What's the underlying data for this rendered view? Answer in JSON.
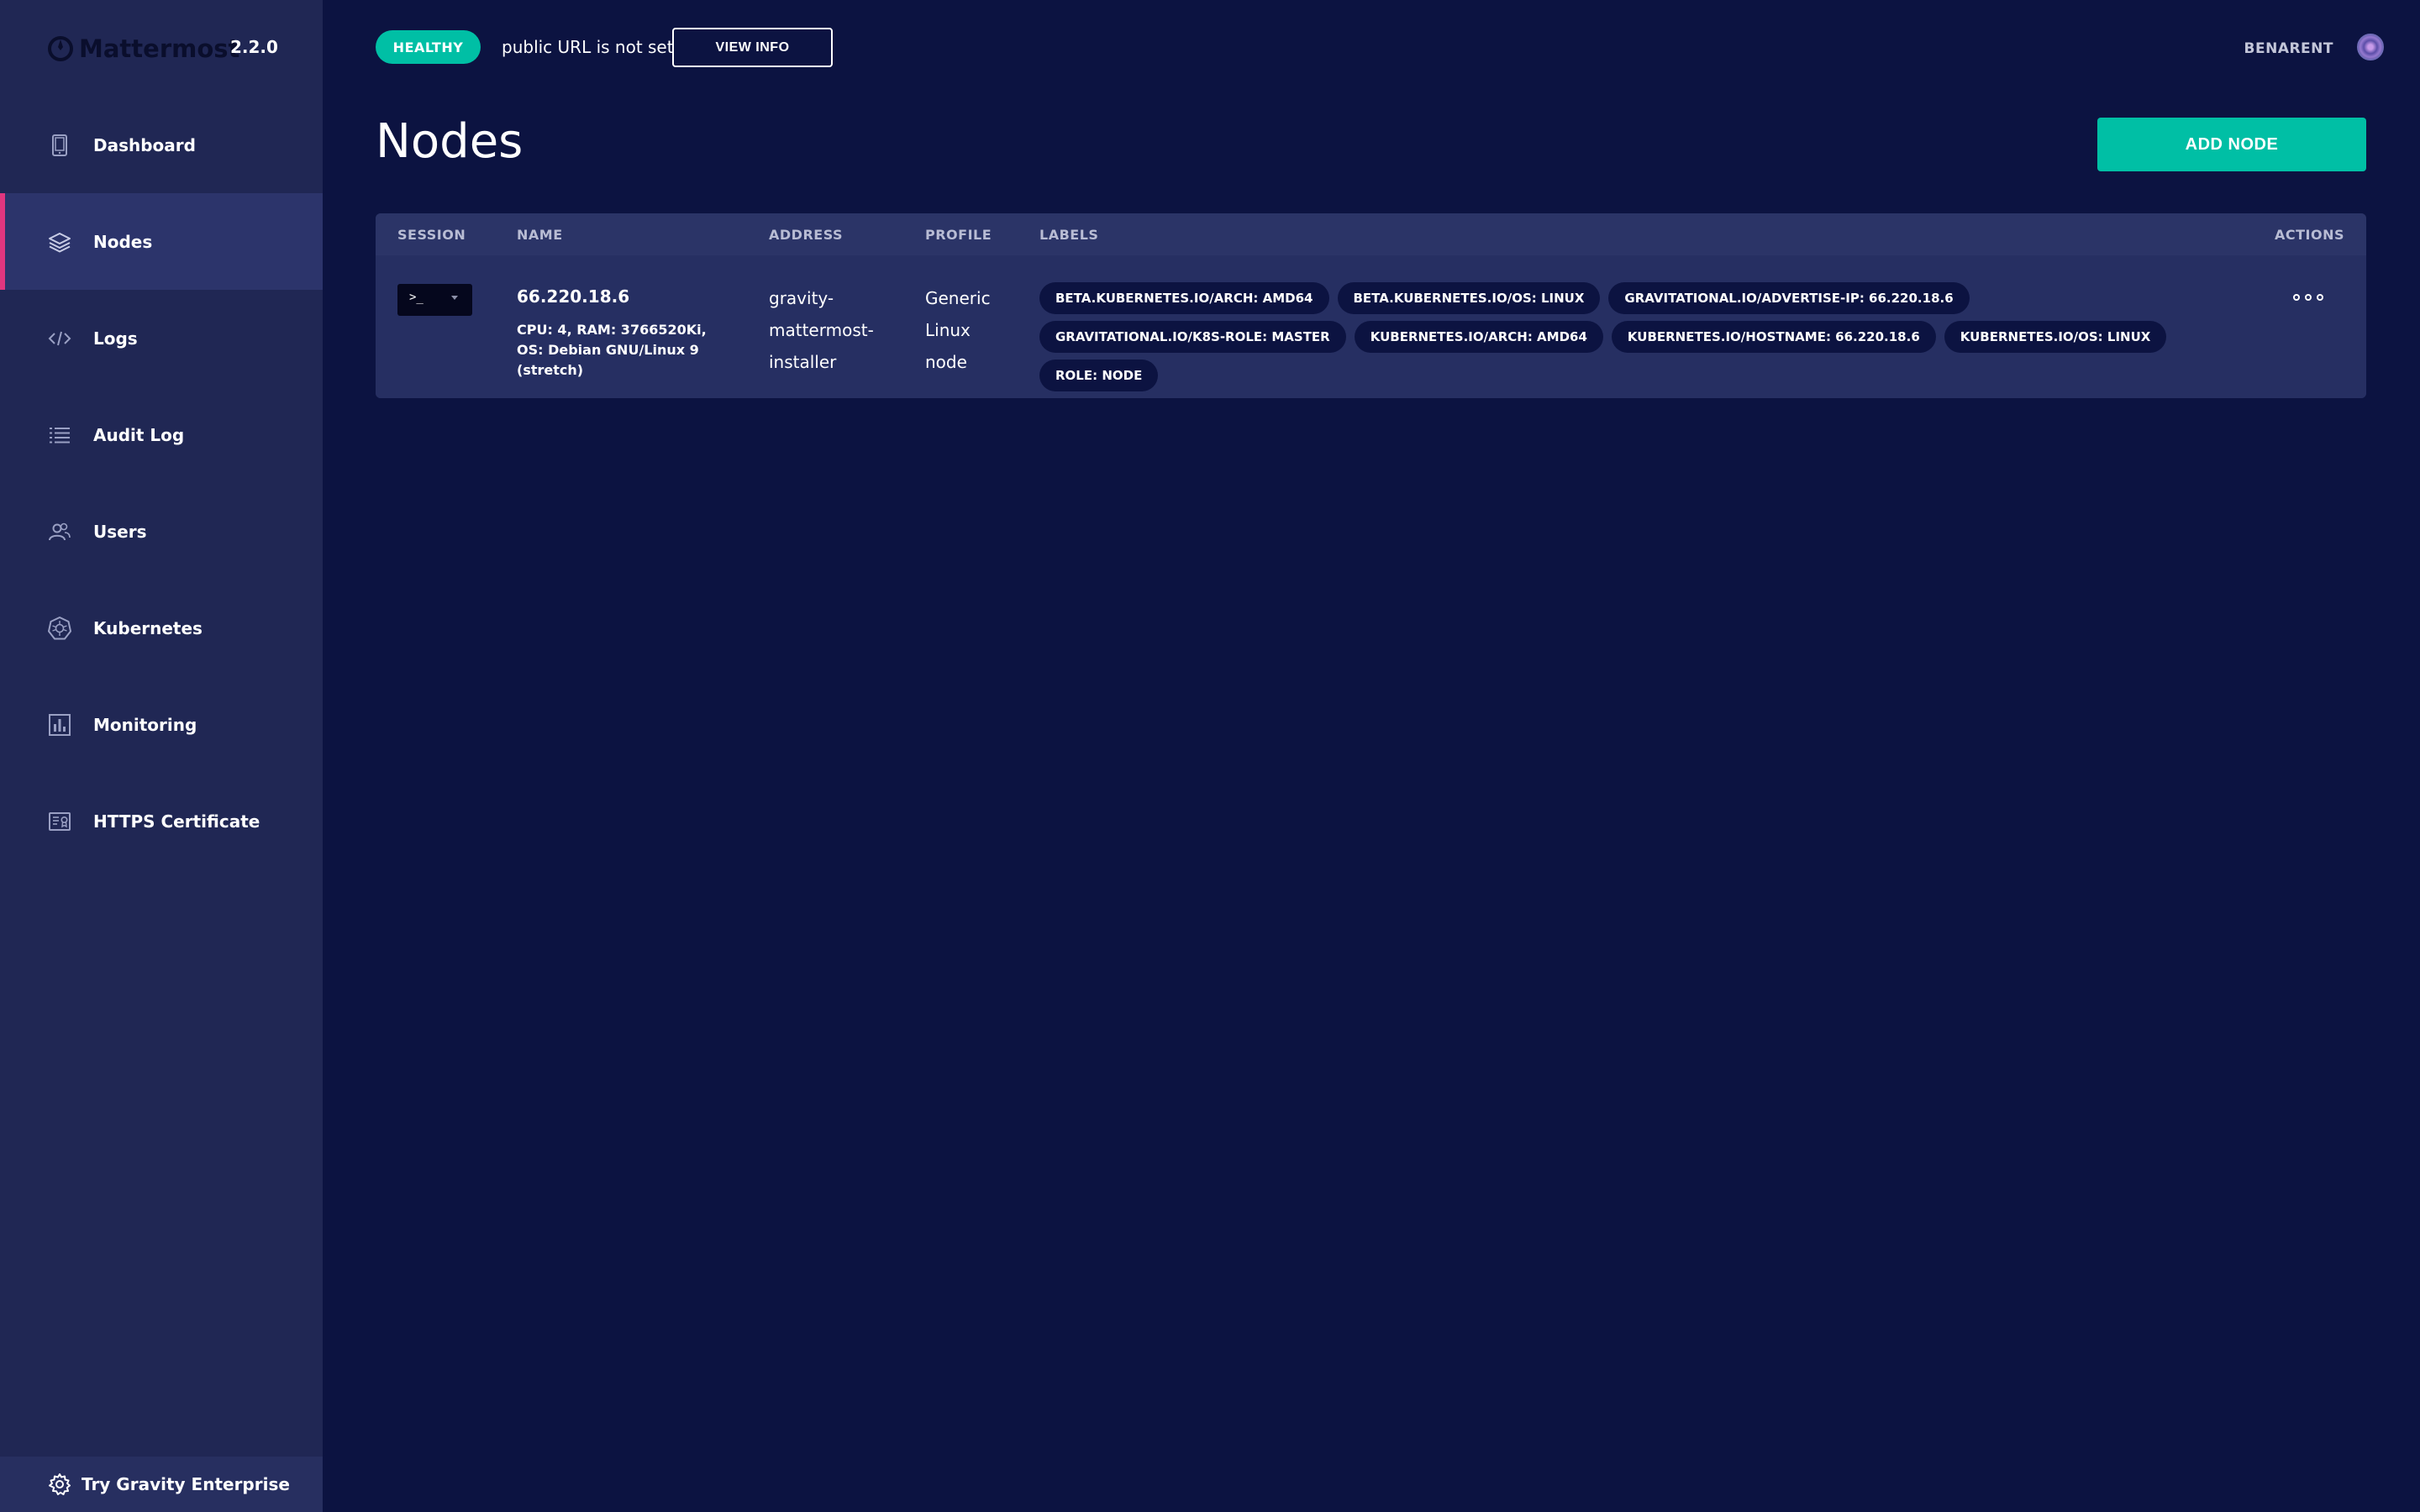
{
  "app": {
    "name": "Mattermost",
    "version": "2.2.0"
  },
  "sidebar": {
    "items": [
      {
        "label": "Dashboard",
        "icon": "tablet-icon",
        "active": false
      },
      {
        "label": "Nodes",
        "icon": "layers-icon",
        "active": true
      },
      {
        "label": "Logs",
        "icon": "code-icon",
        "active": false
      },
      {
        "label": "Audit Log",
        "icon": "list-icon",
        "active": false
      },
      {
        "label": "Users",
        "icon": "users-icon",
        "active": false
      },
      {
        "label": "Kubernetes",
        "icon": "kubernetes-icon",
        "active": false
      },
      {
        "label": "Monitoring",
        "icon": "bar-chart-icon",
        "active": false
      },
      {
        "label": "HTTPS Certificate",
        "icon": "certificate-icon",
        "active": false
      }
    ],
    "footer": {
      "label": "Try Gravity Enterprise",
      "icon": "gear-icon"
    }
  },
  "topbar": {
    "status": "HEALTHY",
    "message": "public URL is not set",
    "view_info": "VIEW INFO",
    "username": "BENARENT"
  },
  "header": {
    "title": "Nodes",
    "add_button": "ADD NODE"
  },
  "table": {
    "columns": [
      "SESSION",
      "NAME",
      "ADDRESS",
      "PROFILE",
      "LABELS",
      "ACTIONS"
    ],
    "rows": [
      {
        "session_prompt": ">_",
        "name": "66.220.18.6",
        "specs": "CPU: 4, RAM: 3766520Ki, OS: Debian GNU/Linux 9 (stretch)",
        "address": "gravity-mattermost-installer",
        "profile": "Generic Linux node",
        "labels": [
          "BETA.KUBERNETES.IO/ARCH: AMD64",
          "BETA.KUBERNETES.IO/OS: LINUX",
          "GRAVITATIONAL.IO/ADVERTISE-IP: 66.220.18.6",
          "GRAVITATIONAL.IO/K8S-ROLE: MASTER",
          "KUBERNETES.IO/ARCH: AMD64",
          "KUBERNETES.IO/HOSTNAME: 66.220.18.6",
          "KUBERNETES.IO/OS: LINUX",
          "ROLE: NODE"
        ]
      }
    ]
  },
  "colors": {
    "background": "#0c1341",
    "sidebar": "#202754",
    "sidebar_active": "#2c346b",
    "active_indicator": "#e0367f",
    "accent": "#00bfa5",
    "chip": "#0c1341",
    "table_row": "#262f62"
  }
}
